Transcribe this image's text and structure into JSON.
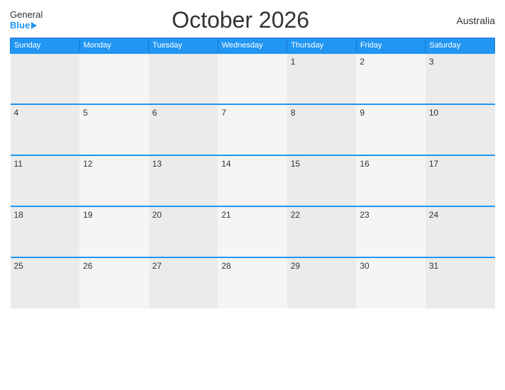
{
  "header": {
    "logo_general": "General",
    "logo_blue": "Blue",
    "title": "October 2026",
    "country": "Australia"
  },
  "weekdays": [
    "Sunday",
    "Monday",
    "Tuesday",
    "Wednesday",
    "Thursday",
    "Friday",
    "Saturday"
  ],
  "weeks": [
    [
      null,
      null,
      null,
      null,
      1,
      2,
      3
    ],
    [
      4,
      5,
      6,
      7,
      8,
      9,
      10
    ],
    [
      11,
      12,
      13,
      14,
      15,
      16,
      17
    ],
    [
      18,
      19,
      20,
      21,
      22,
      23,
      24
    ],
    [
      25,
      26,
      27,
      28,
      29,
      30,
      31
    ]
  ]
}
